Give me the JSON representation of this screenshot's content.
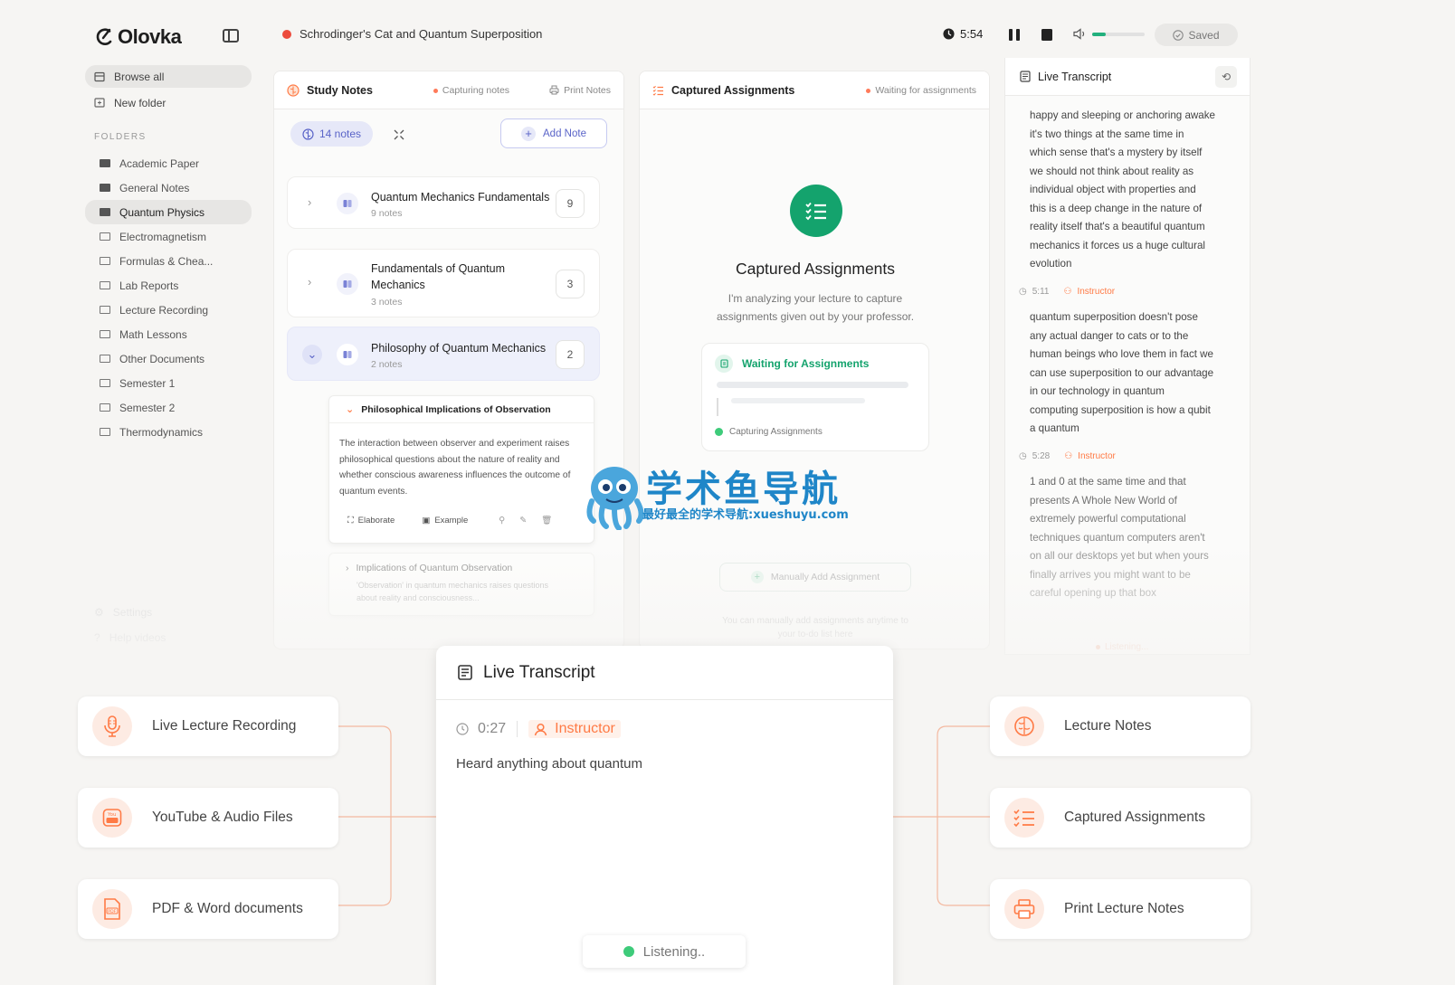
{
  "app": {
    "name": "Olovka"
  },
  "header": {
    "recording_title": "Schrodinger's Cat and Quantum Superposition",
    "timer": "5:54",
    "volume_level": 0.25,
    "saved_label": "Saved"
  },
  "sidebar": {
    "browse_all": "Browse all",
    "new_folder": "New folder",
    "folders_heading": "FOLDERS",
    "folders": [
      {
        "label": "Academic Paper",
        "filled": true
      },
      {
        "label": "General Notes",
        "filled": true
      },
      {
        "label": "Quantum Physics",
        "filled": true,
        "active": true
      },
      {
        "label": "Electromagnetism"
      },
      {
        "label": "Formulas & Chea..."
      },
      {
        "label": "Lab Reports"
      },
      {
        "label": "Lecture Recording"
      },
      {
        "label": "Math Lessons"
      },
      {
        "label": "Other Documents"
      },
      {
        "label": "Semester 1"
      },
      {
        "label": "Semester 2"
      },
      {
        "label": "Thermodynamics"
      }
    ],
    "settings": "Settings",
    "help": "Help videos"
  },
  "study_notes": {
    "title": "Study Notes",
    "status": "Capturing notes",
    "print": "Print Notes",
    "count_chip": "14 notes",
    "add_note": "Add Note",
    "groups": [
      {
        "title": "Quantum Mechanics Fundamentals",
        "sub": "9 notes",
        "count": "9"
      },
      {
        "title_line1": "Fundamentals of Quantum",
        "title_line2": "Mechanics",
        "sub": "3 notes",
        "count": "3"
      },
      {
        "title": "Philosophy of Quantum Mechanics",
        "sub": "2 notes",
        "count": "2"
      }
    ],
    "expanded_note": {
      "title": "Philosophical Implications of Observation",
      "body": "The interaction between observer and experiment raises philosophical questions about the nature of reality and whether conscious awareness influences the outcome of quantum events.",
      "actions": [
        "Elaborate",
        "Example"
      ]
    },
    "collapsed_note": {
      "title": "Implications of Quantum Observation",
      "body": "'Observation' in quantum mechanics raises questions about reality and consciousness..."
    }
  },
  "assignments": {
    "title": "Captured Assignments",
    "status": "Waiting for assignments",
    "heading": "Captured Assignments",
    "desc_line1": "I'm analyzing your lecture to capture",
    "desc_line2": "assignments given out by your professor.",
    "waiting_title": "Waiting for Assignments",
    "capturing": "Capturing Assignments",
    "manual_add": "Manually Add Assignment",
    "hint_line1": "You can manually add assignments anytime to",
    "hint_line2": "your to-do list here"
  },
  "transcript_panel": {
    "title": "Live Transcript",
    "lines_top": [
      "happy and sleeping or anchoring awake",
      "it's two things at the same time in",
      "which sense that's a mystery by itself",
      "we should not think about reality as",
      "individual object with properties and",
      "this is a deep change in the nature of",
      "reality itself that's a beautiful quantum",
      "mechanics it forces us a huge cultural",
      "evolution"
    ],
    "segments": [
      {
        "time": "5:11",
        "speaker": "Instructor",
        "lines": [
          "quantum superposition doesn't pose",
          "any actual danger to cats or to the",
          "human beings who love them in fact we",
          "can use superposition to our advantage",
          "in our technology in quantum",
          "computing superposition is how a qubit",
          "a quantum"
        ]
      },
      {
        "time": "5:28",
        "speaker": "Instructor",
        "lines": [
          "1 and 0 at the same time and that",
          "presents A Whole New World of",
          "extremely powerful computational",
          "techniques quantum computers aren't",
          "on all our desktops yet but when yours",
          "finally arrives you might want to be",
          "careful opening up that box"
        ]
      }
    ],
    "listening": "Listening..."
  },
  "features_left": [
    {
      "label": "Live Lecture Recording",
      "icon": "microphone-icon"
    },
    {
      "label": "YouTube & Audio Files",
      "icon": "youtube-icon"
    },
    {
      "label": "PDF & Word documents",
      "icon": "pdf-icon"
    }
  ],
  "features_right": [
    {
      "label": "Lecture Notes",
      "icon": "brain-icon"
    },
    {
      "label": "Captured Assignments",
      "icon": "checklist-icon"
    },
    {
      "label": "Print Lecture Notes",
      "icon": "printer-icon"
    }
  ],
  "popup": {
    "title": "Live Transcript",
    "time": "0:27",
    "speaker": "Instructor",
    "text": "Heard anything about quantum",
    "listening": "Listening.."
  },
  "watermark": {
    "title": "学术鱼导航",
    "subtitle": "最好最全的学术导航:xueshuyu.com"
  },
  "colors": {
    "accent": "#ff7a45",
    "indigo": "#5a64c8",
    "green": "#14a36d",
    "recording": "#ec4b3c"
  }
}
